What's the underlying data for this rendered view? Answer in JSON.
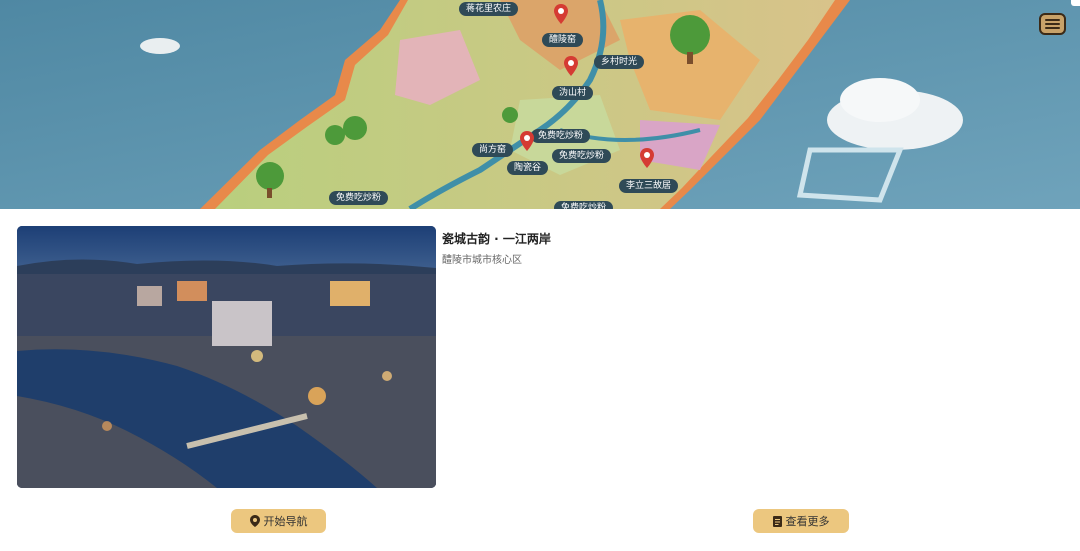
{
  "map": {
    "labels": [
      "蒋花里农庄",
      "醴陵窑",
      "乡村时光",
      "沩山村",
      "尚方窑",
      "免费吃炒粉",
      "陶瓷谷",
      "免费吃炒粉",
      "李立三故居",
      "免费吃炒粉",
      "免费吃炒粉"
    ],
    "menu_icon": "hamburger-menu-icon"
  },
  "card": {
    "title": "瓷城古韵 · 一江两岸",
    "subtitle": "醴陵市城市核心区"
  },
  "actions": {
    "navigate_label": "开始导航",
    "navigate_icon": "location-pin-icon",
    "more_label": "查看更多",
    "more_icon": "document-icon"
  },
  "colors": {
    "button_bg": "#ecc77f",
    "map_label_bg": "#2f4a57",
    "sea": "#5c93ad"
  }
}
